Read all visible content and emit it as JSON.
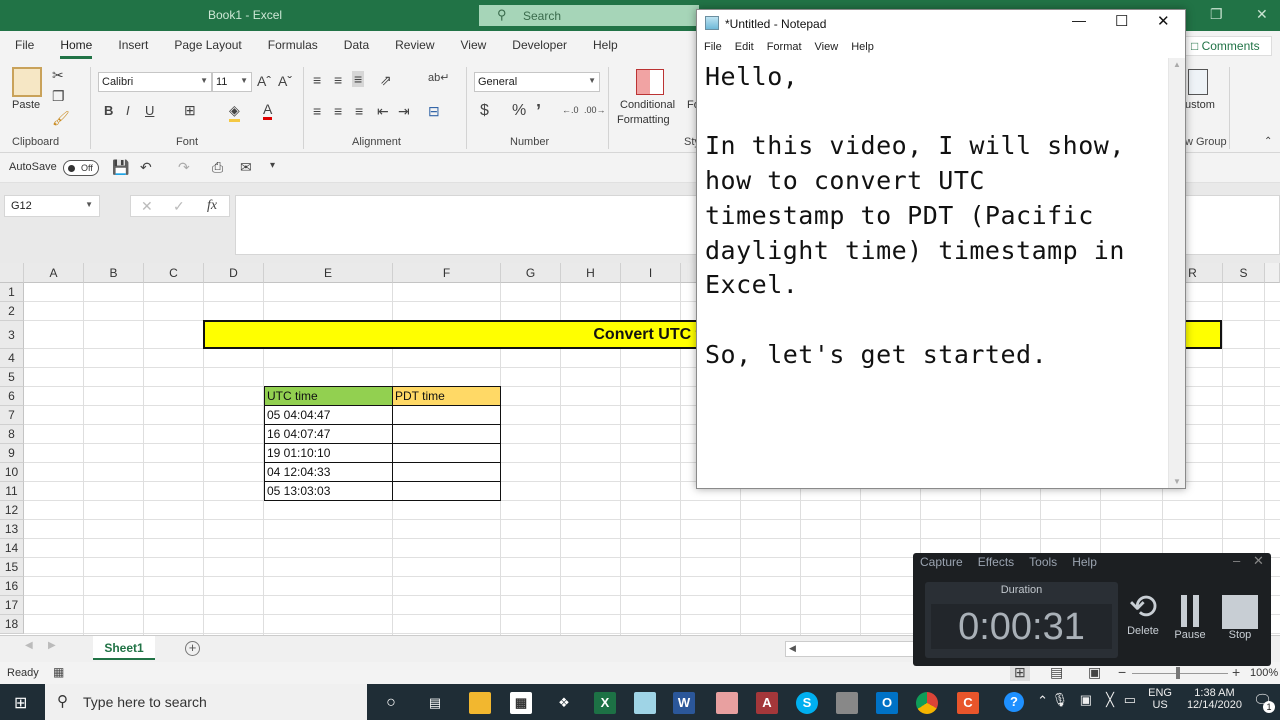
{
  "excel": {
    "title": "Book1 - Excel",
    "search_placeholder": "Search",
    "tabs": [
      "File",
      "Home",
      "Insert",
      "Page Layout",
      "Formulas",
      "Data",
      "Review",
      "View",
      "Developer",
      "Help"
    ],
    "active_tab": "Home",
    "comments_label": "Comments",
    "ribbon": {
      "clipboard": {
        "paste": "Paste",
        "group": "Clipboard"
      },
      "font": {
        "name": "Calibri",
        "size": "11",
        "bold": "B",
        "italic": "I",
        "underline": "U",
        "group": "Font"
      },
      "alignment": {
        "group": "Alignment"
      },
      "number": {
        "format": "General",
        "currency": "$",
        "percent": "%",
        "comma": "’",
        "group": "Number"
      },
      "styles": {
        "conditional_line1": "Conditional",
        "conditional_line2": "Formatting",
        "format_partial": "Fo",
        "group_partial": "Sty"
      },
      "custom": {
        "label_partial": "ustom",
        "group_partial": "w Group"
      }
    },
    "qat": {
      "autosave_label": "AutoSave",
      "autosave_state": "Off"
    },
    "formula_bar": {
      "name_box": "G12",
      "cancel": "✕",
      "enter": "✓",
      "fx": "fx",
      "formula": ""
    },
    "columns": [
      "A",
      "B",
      "C",
      "D",
      "E",
      "F",
      "G",
      "H",
      "I",
      "R",
      "S"
    ],
    "rows": [
      "1",
      "2",
      "3",
      "4",
      "5",
      "6",
      "7",
      "8",
      "9",
      "10",
      "11",
      "12",
      "13",
      "14",
      "15",
      "16",
      "17",
      "18"
    ],
    "banner_text": "Convert UTC timestamp to PDT",
    "table": {
      "headers": [
        "UTC time",
        "PDT time"
      ],
      "header_colors": [
        "#92d050",
        "#ffd966"
      ],
      "rows": [
        [
          "05 04:04:47",
          ""
        ],
        [
          "16 04:07:47",
          ""
        ],
        [
          "19 01:10:10",
          ""
        ],
        [
          "04 12:04:33",
          ""
        ],
        [
          "05 13:03:03",
          ""
        ]
      ]
    },
    "sheet_tab": "Sheet1",
    "status": "Ready",
    "zoom": "100%"
  },
  "notepad": {
    "title": "*Untitled - Notepad",
    "menu": [
      "File",
      "Edit",
      "Format",
      "View",
      "Help"
    ],
    "text": "Hello,\n\nIn this video, I will show,\nhow to convert UTC\ntimestamp to PDT (Pacific\ndaylight time) timestamp in\nExcel.\n\nSo, let's get started."
  },
  "recorder": {
    "menu": [
      "Capture",
      "Effects",
      "Tools",
      "Help"
    ],
    "duration_label": "Duration",
    "duration": "0:00:31",
    "buttons": [
      "Delete",
      "Pause",
      "Stop"
    ]
  },
  "taskbar": {
    "search_placeholder": "Type here to search",
    "language": "ENG",
    "region": "US",
    "time": "1:38 AM",
    "date": "12/14/2020",
    "notifications": "1"
  }
}
